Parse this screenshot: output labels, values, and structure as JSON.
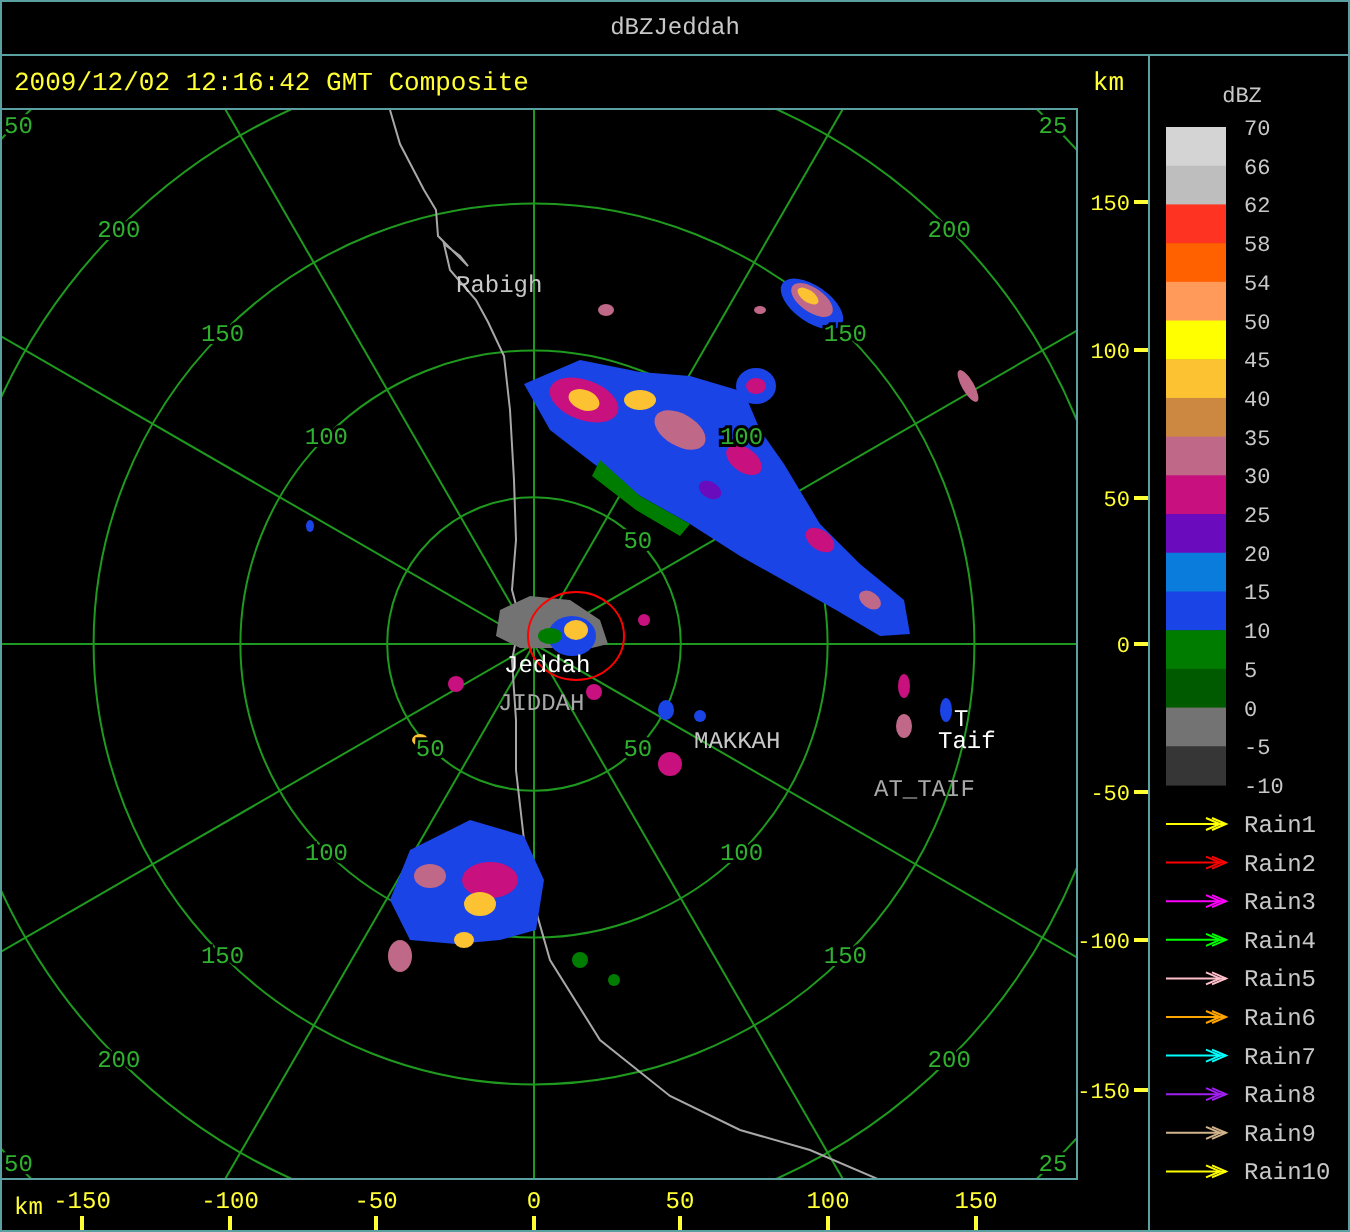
{
  "window": {
    "title": "dBZJeddah"
  },
  "header": {
    "timestamp": "2009/12/02 12:16:42 GMT Composite",
    "unit": "km"
  },
  "radar_map": {
    "range_rings": [
      {
        "labels": {
          "ne": "50",
          "se": "50",
          "sw": "50"
        }
      },
      {
        "labels": {
          "nw": "100",
          "ne": "100",
          "sw": "100",
          "se": "100"
        }
      },
      {
        "labels": {
          "nw": "150",
          "ne": "150",
          "sw": "150",
          "se": "150"
        }
      },
      {
        "labels": {
          "nw": "200",
          "ne": "200",
          "sw": "200",
          "se": "200"
        }
      },
      {
        "labels": {
          "nw": "50",
          "ne": "25",
          "sw": "50",
          "se": "25"
        }
      }
    ],
    "places": [
      {
        "text": "Rabigh",
        "color": "#c8c8c8"
      },
      {
        "text": "Jeddah",
        "color": "#ffffff"
      },
      {
        "text": "JIDDAH",
        "color": "#a8a8a8"
      },
      {
        "text": "MAKKAH",
        "color": "#c8c8c8"
      },
      {
        "text": "T",
        "color": "#ffffff"
      },
      {
        "text": "Taif",
        "color": "#ffffff"
      },
      {
        "text": "AT_TAIF",
        "color": "#a8a8a8"
      }
    ]
  },
  "y_axis": {
    "ticks": [
      "150",
      "100",
      "50",
      "0",
      "-50",
      "-100",
      "-150"
    ]
  },
  "x_axis": {
    "unit": "km",
    "ticks": [
      "-150",
      "-100",
      "-50",
      "0",
      "50",
      "100",
      "150"
    ]
  },
  "legend": {
    "title": "dBZ",
    "labels": [
      "70",
      "66",
      "62",
      "58",
      "54",
      "50",
      "45",
      "40",
      "35",
      "30",
      "25",
      "20",
      "15",
      "10",
      "5",
      "0",
      "-5",
      "-10"
    ],
    "segments": [
      {
        "color": "#d4d4d4"
      },
      {
        "color": "#bebebe"
      },
      {
        "color": "#ff3322"
      },
      {
        "color": "#ff6000"
      },
      {
        "color": "#ff9a5a"
      },
      {
        "color": "#ffff00"
      },
      {
        "color": "#fcc232"
      },
      {
        "color": "#cc8840"
      },
      {
        "color": "#c06888"
      },
      {
        "color": "#c8107e"
      },
      {
        "color": "#6a0cbe"
      },
      {
        "color": "#0a7ddc"
      },
      {
        "color": "#1a44e6"
      },
      {
        "color": "#007d00"
      },
      {
        "color": "#005a00"
      },
      {
        "color": "#737373"
      },
      {
        "color": "#363636"
      }
    ],
    "tracks": [
      {
        "label": "Rain1",
        "color": "#ffff00"
      },
      {
        "label": "Rain2",
        "color": "#ff0000"
      },
      {
        "label": "Rain3",
        "color": "#ff00ff"
      },
      {
        "label": "Rain4",
        "color": "#00ff00"
      },
      {
        "label": "Rain5",
        "color": "#ffc0cb"
      },
      {
        "label": "Rain6",
        "color": "#ffa500"
      },
      {
        "label": "Rain7",
        "color": "#00ffff"
      },
      {
        "label": "Rain8",
        "color": "#a020f0"
      },
      {
        "label": "Rain9",
        "color": "#d2b48c"
      },
      {
        "label": "Rain10",
        "color": "#ffff00"
      }
    ]
  }
}
